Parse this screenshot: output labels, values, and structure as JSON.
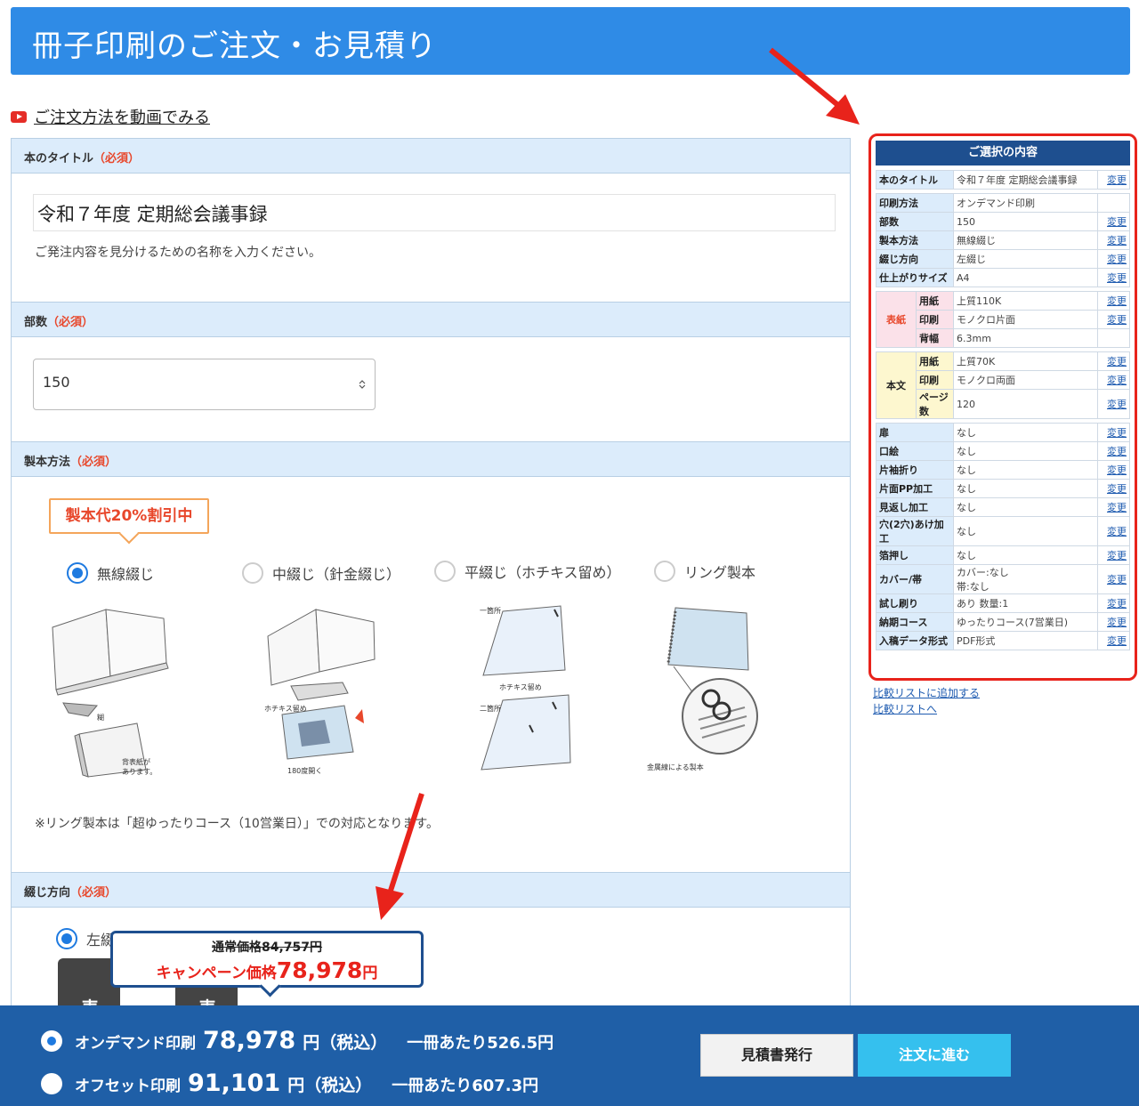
{
  "header": {
    "title": "冊子印刷のご注文・お見積り"
  },
  "video_link": {
    "label": "ご注文方法を動画でみる"
  },
  "sections": {
    "title": {
      "label": "本のタイトル",
      "required": "（必須）",
      "value": "令和７年度 定期総会議事録",
      "helper": "ご発注内容を見分けるための名称を入力ください。"
    },
    "quantity": {
      "label": "部数",
      "required": "（必須）",
      "value": "150"
    },
    "binding": {
      "label": "製本方法",
      "required": "（必須）",
      "campaign_badge": "製本代20%割引中",
      "options": [
        "無線綴じ",
        "中綴じ（針金綴じ）",
        "平綴じ（ホチキス留め）",
        "リング製本"
      ],
      "selected": "無線綴じ",
      "captions": {
        "glue": "糊",
        "cover_back": "背表紙が",
        "cover_back2": "あります。",
        "stapler": "ホチキス留め",
        "open180": "180度開く",
        "one_spot": "一箇所",
        "staple": "ホチキス留め",
        "two_spot": "二箇所",
        "ring": "金属線による製本"
      },
      "note": "※リング製本は「超ゆったりコース（10営業日）」での対応となります。"
    },
    "direction": {
      "label": "綴じ方向",
      "required": "（必須）",
      "option_left": "左綴",
      "card_char": "表"
    }
  },
  "price_popup": {
    "regular": "通常価格84,757円",
    "campaign_prefix": "キャンペーン価格",
    "campaign_amount": "78,978",
    "campaign_unit": "円"
  },
  "bottom": {
    "ondemand": {
      "method": "オンデマンド印刷",
      "amount": "78,978",
      "unit": "円（税込）",
      "per": "一冊あたり526.5円",
      "selected": true
    },
    "offset": {
      "method": "オフセット印刷",
      "amount": "91,101",
      "unit": "円（税込）",
      "per": "一冊あたり607.3円",
      "selected": false
    },
    "estimate_button": "見積書発行",
    "order_button": "注文に進む"
  },
  "summary": {
    "title": "ご選択の内容",
    "change": "変更",
    "book_title": {
      "label": "本のタイトル",
      "value": "令和７年度 定期総会議事録"
    },
    "basic": [
      {
        "label": "印刷方法",
        "value": "オンデマンド印刷",
        "change": false
      },
      {
        "label": "部数",
        "value": "150",
        "change": true
      },
      {
        "label": "製本方法",
        "value": "無線綴じ",
        "change": true
      },
      {
        "label": "綴じ方向",
        "value": "左綴じ",
        "change": true
      },
      {
        "label": "仕上がりサイズ",
        "value": "A4",
        "change": true
      }
    ],
    "cover": {
      "label": "表紙",
      "rows": [
        {
          "label": "用紙",
          "value": "上質110K",
          "change": true
        },
        {
          "label": "印刷",
          "value": "モノクロ片面",
          "change": true
        },
        {
          "label": "背幅",
          "value": "6.3mm",
          "change": false
        }
      ]
    },
    "body": {
      "label": "本文",
      "rows": [
        {
          "label": "用紙",
          "value": "上質70K",
          "change": true
        },
        {
          "label": "印刷",
          "value": "モノクロ両面",
          "change": true
        },
        {
          "label": "ページ数",
          "value": "120",
          "change": true
        }
      ]
    },
    "options": [
      {
        "label": "扉",
        "value": "なし"
      },
      {
        "label": "口絵",
        "value": "なし"
      },
      {
        "label": "片袖折り",
        "value": "なし"
      },
      {
        "label": "片面PP加工",
        "value": "なし"
      },
      {
        "label": "見返し加工",
        "value": "なし"
      },
      {
        "label": "穴(2穴)あけ加工",
        "value": "なし"
      },
      {
        "label": "箔押し",
        "value": "なし"
      },
      {
        "label": "カバー/帯",
        "value": "カバー:なし",
        "value2": "帯:なし"
      },
      {
        "label": "試し刷り",
        "value": "あり 数量:1"
      },
      {
        "label": "納期コース",
        "value": "ゆったりコース(7営業日)"
      },
      {
        "label": "入稿データ形式",
        "value": "PDF形式"
      }
    ],
    "compare_add": "比較リストに追加する",
    "compare_go": "比較リストへ"
  },
  "colors": {
    "header": "#2f8be6",
    "section": "#dcecfb",
    "bottom": "#1f5fa7",
    "order": "#35c0ee",
    "highlight": "#e8231b"
  }
}
